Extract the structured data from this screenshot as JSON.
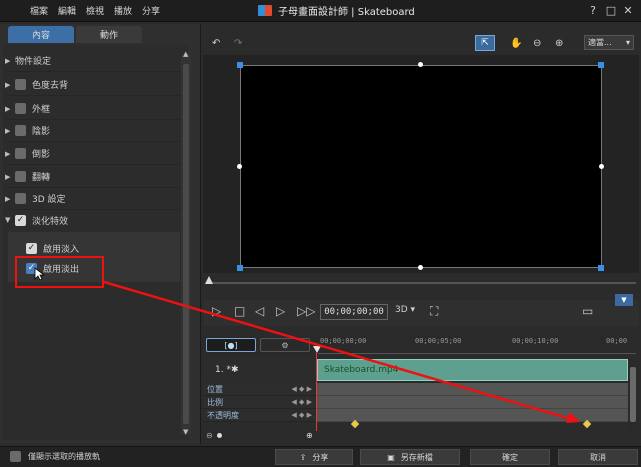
{
  "menu": [
    "檔案",
    "編輯",
    "檢視",
    "播放",
    "分享"
  ],
  "window": {
    "title": "子母畫面設計師 | Skateboard",
    "help": "?",
    "maximize": "□",
    "close": "✕"
  },
  "tabs": [
    "內容",
    "動作"
  ],
  "properties": [
    {
      "label": "物件設定",
      "expanded": false,
      "has_checkbox": false
    },
    {
      "label": "色度去背",
      "expanded": false,
      "has_checkbox": true,
      "checked": false
    },
    {
      "label": "外框",
      "expanded": false,
      "has_checkbox": true,
      "checked": false
    },
    {
      "label": "陰影",
      "expanded": false,
      "has_checkbox": true,
      "checked": false
    },
    {
      "label": "倒影",
      "expanded": false,
      "has_checkbox": true,
      "checked": false
    },
    {
      "label": "翻轉",
      "expanded": false,
      "has_checkbox": true,
      "checked": false
    },
    {
      "label": "3D 設定",
      "expanded": false,
      "has_checkbox": true,
      "checked": false
    },
    {
      "label": "淡化特效",
      "expanded": true,
      "has_checkbox": true,
      "checked": true
    }
  ],
  "fade": {
    "fade_in": {
      "label": "啟用淡入",
      "checked": true
    },
    "fade_out": {
      "label": "啟用淡出",
      "checked": true
    }
  },
  "preview_toolbar": {
    "undo": "↶",
    "redo": "↷",
    "zoom_select": "適當...",
    "dropdown_arrow": "▾"
  },
  "playback": {
    "timecode": "00;00;00;00",
    "mode3d": "3D ▾"
  },
  "timeline": {
    "ruler_labels": [
      "00;00;00;00",
      "00;00;05;00",
      "00;00;10;00",
      "00;00"
    ],
    "track_label": "1. *✱",
    "clip_name": "Skateboard.mp4",
    "keyframe_tracks": [
      "位置",
      "比例",
      "不透明度"
    ]
  },
  "bottom": {
    "show_selected_label": "僅顯示選取的播放軌",
    "share": "分享",
    "save_as": "另存新檔",
    "ok": "確定",
    "cancel": "取消"
  },
  "colors": {
    "accent": "#3b6fa6",
    "highlight": "#ee1111",
    "clip": "#5f9f8f",
    "keyframe": "#e8c74a"
  }
}
